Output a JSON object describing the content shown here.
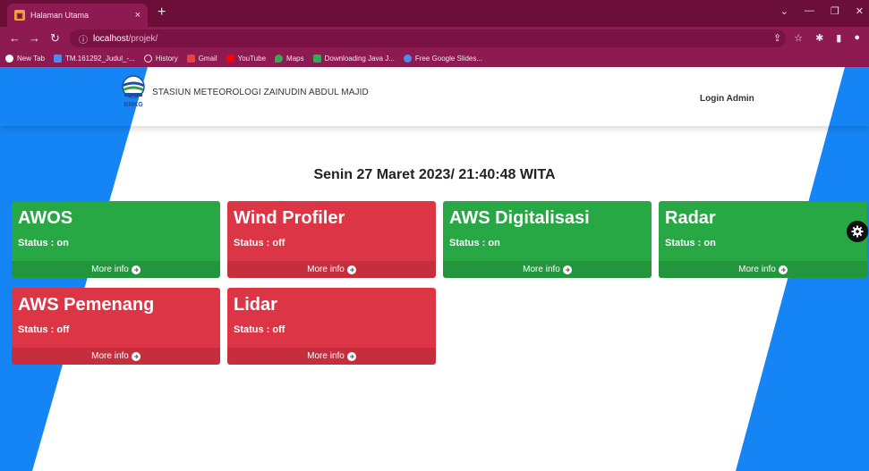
{
  "browser": {
    "tab_title": "Halaman Utama",
    "tab_close": "×",
    "new_tab": "+",
    "url_host": "localhost",
    "url_path": "/projek/",
    "bookmarks": [
      {
        "label": "New Tab",
        "color": "#ffffff"
      },
      {
        "label": "TM.161292_Judul_-...",
        "color": "#4a8cf0"
      },
      {
        "label": "History",
        "color": "#f3e6ec"
      },
      {
        "label": "Gmail",
        "color": "#ea4335"
      },
      {
        "label": "YouTube",
        "color": "#ff0000"
      },
      {
        "label": "Maps",
        "color": "#34a853"
      },
      {
        "label": "Downloading Java J...",
        "color": "#34a853"
      },
      {
        "label": "Free Google Slides...",
        "color": "#4a8cf0"
      }
    ]
  },
  "header": {
    "logo_text": "BMKG",
    "site_title": "STASIUN METEOROLOGI ZAINUDIN ABDUL MAJID",
    "login_label": "Login Admin"
  },
  "datetime": "Senin 27 Maret 2023/ 21:40:48 WITA",
  "colors": {
    "on": "#28a745",
    "off": "#dc3545",
    "page_blue": "#1585f5",
    "chrome": "#8e1a52"
  },
  "cards": [
    {
      "name": "AWOS",
      "status": "Status : on",
      "state": "on",
      "more": "More info"
    },
    {
      "name": "Wind Profiler",
      "status": "Status : off",
      "state": "off",
      "more": "More info"
    },
    {
      "name": "AWS Digitalisasi",
      "status": "Status : on",
      "state": "on",
      "more": "More info"
    },
    {
      "name": "Radar",
      "status": "Status : on",
      "state": "on",
      "more": "More info"
    },
    {
      "name": "AWS Pemenang",
      "status": "Status : off",
      "state": "off",
      "more": "More info"
    },
    {
      "name": "Lidar",
      "status": "Status : off",
      "state": "off",
      "more": "More info"
    }
  ],
  "icons": {
    "settings": "gear-icon",
    "more_info": "arrow-circle-right-icon"
  }
}
